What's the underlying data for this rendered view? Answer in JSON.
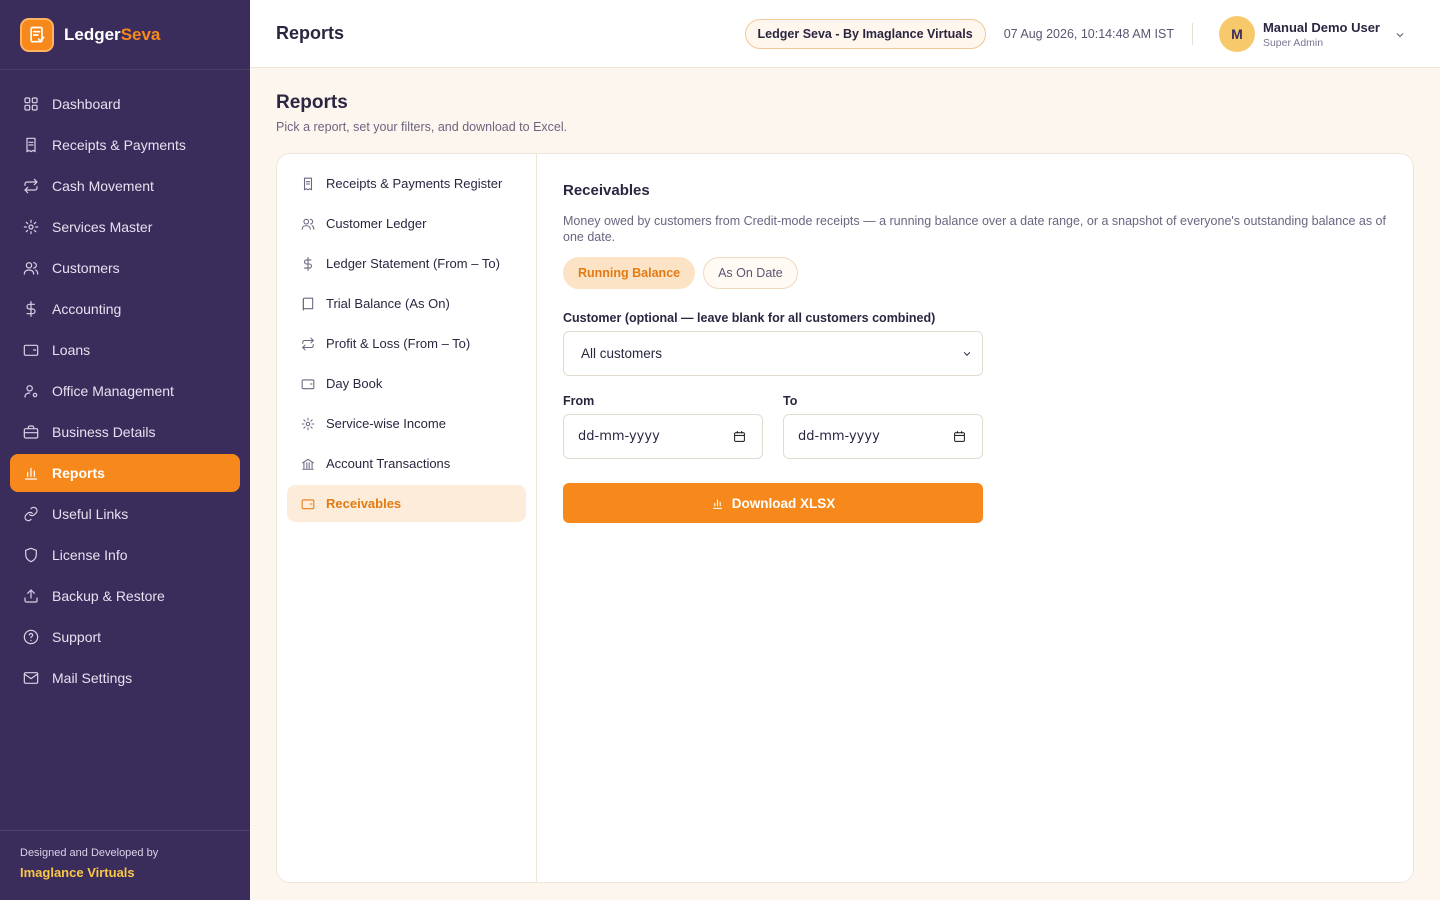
{
  "brand": {
    "name_main": "Ledger",
    "name_accent": "Seva",
    "logo_icon": "ledger-logo-icon"
  },
  "sidebar": {
    "items": [
      {
        "label": "Dashboard",
        "icon": "grid-icon"
      },
      {
        "label": "Receipts & Payments",
        "icon": "receipt-icon"
      },
      {
        "label": "Cash Movement",
        "icon": "arrows-swap-icon"
      },
      {
        "label": "Services Master",
        "icon": "gear-icon"
      },
      {
        "label": "Customers",
        "icon": "users-icon"
      },
      {
        "label": "Accounting",
        "icon": "dollar-icon"
      },
      {
        "label": "Loans",
        "icon": "wallet-icon"
      },
      {
        "label": "Office Management",
        "icon": "user-gear-icon"
      },
      {
        "label": "Business Details",
        "icon": "briefcase-icon"
      },
      {
        "label": "Reports",
        "icon": "bar-chart-icon",
        "active": true
      },
      {
        "label": "Useful Links",
        "icon": "link-icon"
      },
      {
        "label": "License Info",
        "icon": "shield-icon"
      },
      {
        "label": "Backup & Restore",
        "icon": "upload-icon"
      },
      {
        "label": "Support",
        "icon": "help-circle-icon"
      },
      {
        "label": "Mail Settings",
        "icon": "mail-icon"
      }
    ],
    "footer_line1": "Designed and Developed by",
    "footer_line2": "Imaglance Virtuals"
  },
  "topbar": {
    "title": "Reports",
    "brand_pill": "Ledger Seva - By Imaglance Virtuals",
    "timestamp": "07 Aug 2026, 10:14:48 AM IST",
    "user": {
      "initial": "M",
      "name": "Manual Demo User",
      "role": "Super Admin"
    }
  },
  "page": {
    "title": "Reports",
    "subtitle": "Pick a report, set your filters, and download to Excel."
  },
  "reports": {
    "items": [
      {
        "label": "Receipts & Payments Register",
        "icon": "receipt-icon"
      },
      {
        "label": "Customer Ledger",
        "icon": "users-icon"
      },
      {
        "label": "Ledger Statement (From – To)",
        "icon": "dollar-icon"
      },
      {
        "label": "Trial Balance (As On)",
        "icon": "book-icon"
      },
      {
        "label": "Profit & Loss (From – To)",
        "icon": "arrows-swap-icon"
      },
      {
        "label": "Day Book",
        "icon": "wallet-icon"
      },
      {
        "label": "Service-wise Income",
        "icon": "gear-icon"
      },
      {
        "label": "Account Transactions",
        "icon": "bank-icon"
      },
      {
        "label": "Receivables",
        "icon": "wallet-icon",
        "active": true
      }
    ]
  },
  "panel": {
    "title": "Receivables",
    "description": "Money owed by customers from Credit-mode receipts — a running balance over a date range, or a snapshot of everyone's outstanding balance as of one date.",
    "modes": [
      {
        "label": "Running Balance",
        "active": true
      },
      {
        "label": "As On Date",
        "active": false
      }
    ],
    "customer_label": "Customer (optional — leave blank for all customers combined)",
    "customer_value": "All customers",
    "from_label": "From",
    "from_value": "dd-mm-yyyy",
    "to_label": "To",
    "to_value": "dd-mm-yyyy",
    "download_label": "Download XLSX"
  },
  "colors": {
    "accent": "#f7891c",
    "sidebar": "#3b2d5b",
    "background": "#fdf6ef"
  }
}
